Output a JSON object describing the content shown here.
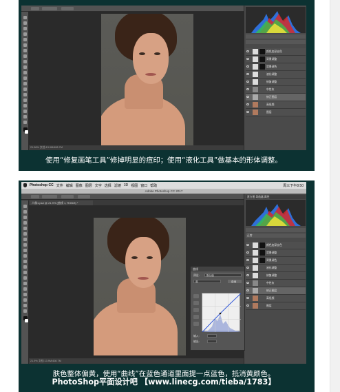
{
  "top_screenshot": {
    "caption": "使用“修复画笔工具”修掉明显的痘印；使用“液化工具”做基本的形体调整。",
    "statusbar": "21.96%   文档:13.9M/408.7M",
    "layers": [
      {
        "name": "颜色加深去色"
      },
      {
        "name": "背景调整"
      },
      {
        "name": "背景调色"
      },
      {
        "name": "液化调整"
      },
      {
        "name": "修复调整"
      },
      {
        "name": "中性灰"
      },
      {
        "name": "修正图层"
      },
      {
        "name": "高低频"
      },
      {
        "name": "图层"
      }
    ]
  },
  "bottom_screenshot": {
    "menubar": {
      "app": "Photoshop CC",
      "items": [
        "文件",
        "编辑",
        "图像",
        "图层",
        "文字",
        "选择",
        "滤镜",
        "3D",
        "视图",
        "窗口",
        "帮助"
      ],
      "status": "周三下午8:50"
    },
    "window_title": "Adobe Photoshop CC 2017",
    "document_tab": "人像1.psd @ 21.9% (曲线 1, RGB/8) *",
    "statusbar": "21.9%   文档:13.9M/408.7M",
    "panel_tabs": "直方图   导航器   属性",
    "layer_mode": "正常",
    "layers": [
      {
        "name": "颜色加深去色"
      },
      {
        "name": "背景调整"
      },
      {
        "name": "背景调色"
      },
      {
        "name": "液化调整"
      },
      {
        "name": "修复调整"
      },
      {
        "name": "中性灰"
      },
      {
        "name": "修正图层"
      },
      {
        "name": "高低频"
      },
      {
        "name": "图层"
      }
    ],
    "curves_dialog": {
      "title": "曲线",
      "preset_label": "预设:",
      "preset_value": "默认值",
      "channel_label": "蓝",
      "auto_button": "自动",
      "input_label": "输入:",
      "output_label": "输出:"
    },
    "caption": "肤色整体偏黄，使用“曲线”在蓝色通道里面提一点蓝色，抵消黄颜色。"
  },
  "footer": "PhotoShop平面设计吧 【www.linecg.com/tieba/1783】"
}
